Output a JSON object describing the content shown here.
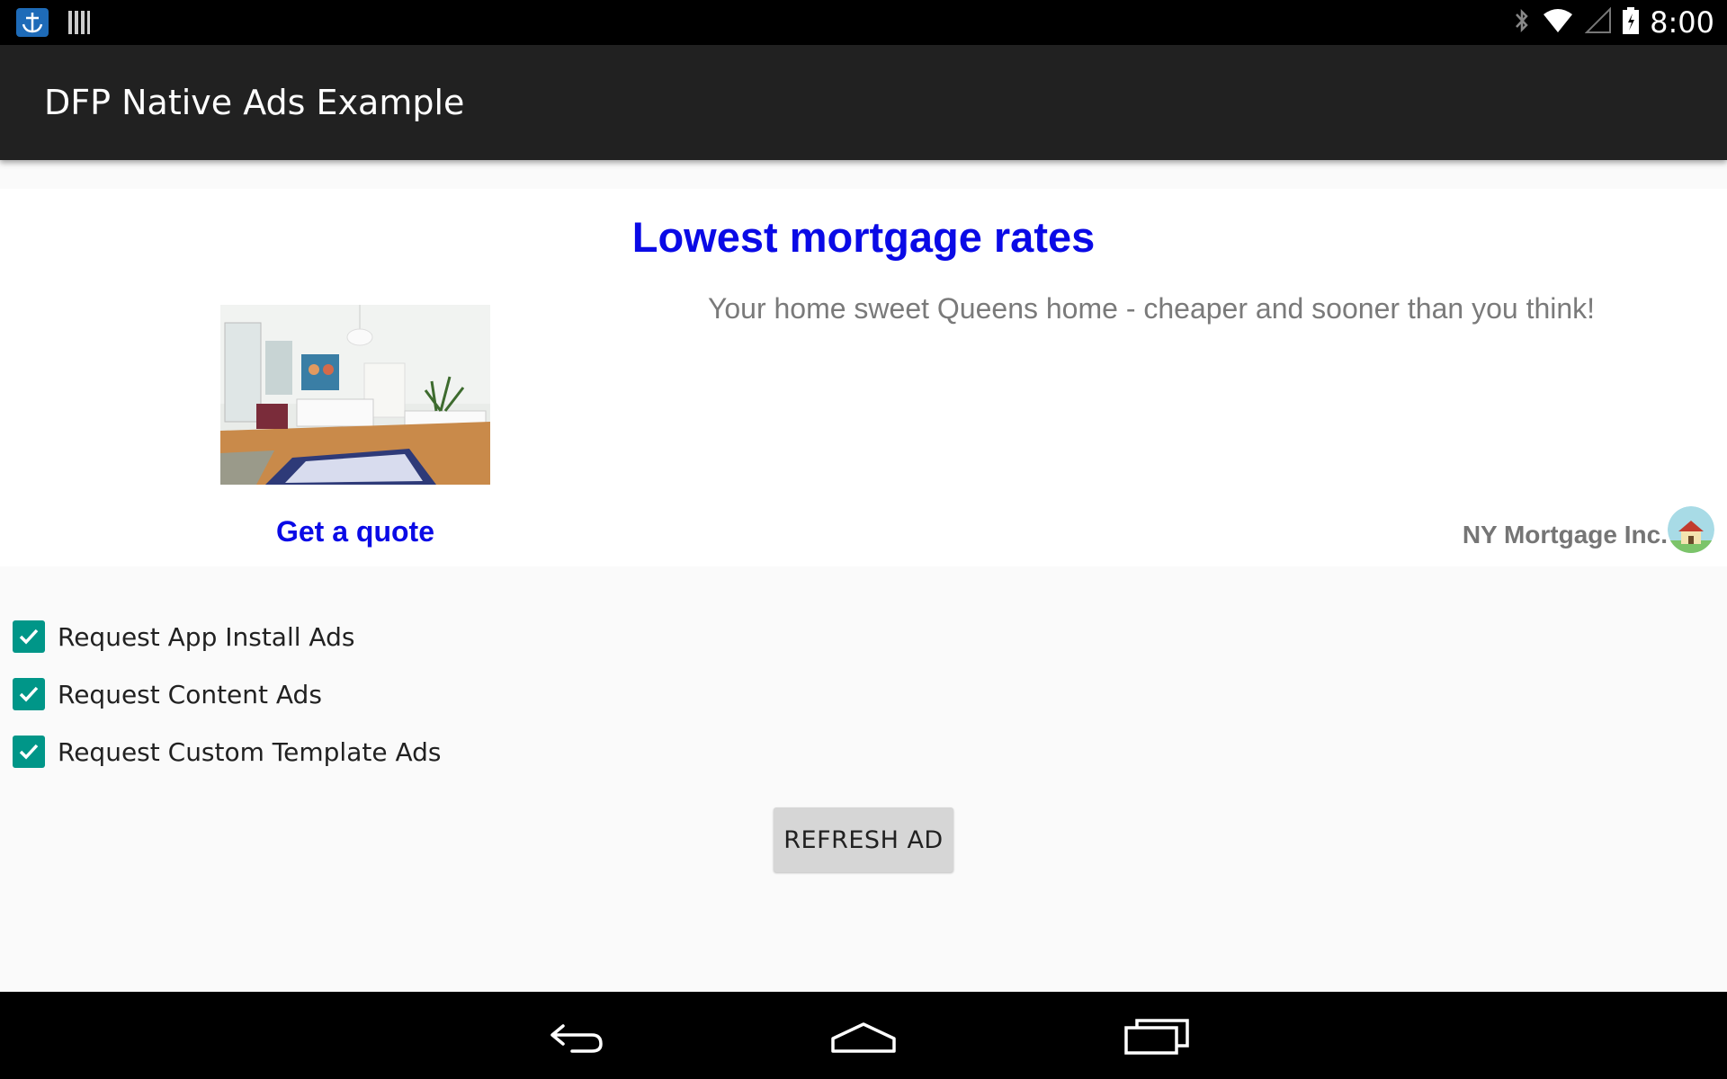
{
  "status_bar": {
    "left_icons": [
      "anchor-app-icon",
      "barcode-app-icon"
    ],
    "right_icons": [
      "bluetooth-icon",
      "wifi-icon",
      "signal-icon",
      "battery-icon"
    ],
    "time": "8:00"
  },
  "app_bar": {
    "title": "DFP Native Ads Example"
  },
  "ad": {
    "headline": "Lowest mortgage rates",
    "body": "Your home sweet Queens home - cheaper and sooner than you think!",
    "call_to_action": "Get a quote",
    "advertiser": "NY Mortgage Inc.",
    "image": "living-room-photo",
    "logo": "house-logo"
  },
  "options": [
    {
      "label": "Request App Install Ads",
      "checked": true
    },
    {
      "label": "Request Content Ads",
      "checked": true
    },
    {
      "label": "Request Custom Template Ads",
      "checked": true
    }
  ],
  "refresh_button": {
    "label": "REFRESH AD"
  },
  "nav_bar": {
    "icons": [
      "back-icon",
      "home-icon",
      "recents-icon"
    ]
  },
  "colors": {
    "headline": "#0a0ae6",
    "checkbox": "#009688",
    "app_bar": "#212121",
    "body_text": "#7a7a7a"
  }
}
